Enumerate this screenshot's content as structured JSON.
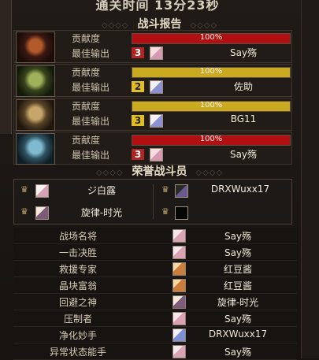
{
  "header": {
    "title": "通关时间 13分23秒"
  },
  "sections": {
    "battle_report": "战斗报告",
    "honor_members": "荣誉战斗员"
  },
  "report": [
    {
      "portrait": "red",
      "contribution_label": "贡献度",
      "contribution_value": "100%",
      "contribution_fill": 1.0,
      "contribution_color": "#b10f12",
      "best_label": "最佳输出",
      "rank": "3",
      "rank_color": "#b32424",
      "name": "Say殇"
    },
    {
      "portrait": "green",
      "contribution_label": "贡献度",
      "contribution_value": "100%",
      "contribution_fill": 1.0,
      "contribution_color": "#c9aa20",
      "best_label": "最佳输出",
      "rank": "2",
      "rank_color": "#e0be1f",
      "name": "佐助"
    },
    {
      "portrait": "gold",
      "contribution_label": "贡献度",
      "contribution_value": "100%",
      "contribution_fill": 1.0,
      "contribution_color": "#c9aa20",
      "best_label": "最佳输出",
      "rank": "3",
      "rank_color": "#e0be1f",
      "name": "BG11"
    },
    {
      "portrait": "teal",
      "contribution_label": "贡献度",
      "contribution_value": "100%",
      "contribution_fill": 1.0,
      "contribution_color": "#b10f12",
      "best_label": "最佳输出",
      "rank": "3",
      "rank_color": "#b32424",
      "name": "Say殇"
    }
  ],
  "honor": [
    {
      "name": "ジ白露"
    },
    {
      "name": "DRXWuxx17"
    },
    {
      "name": "旋律-时光"
    },
    {
      "name": ""
    }
  ],
  "awards": [
    {
      "title": "战场名将",
      "name": "Say殇",
      "avatar": "pinkish"
    },
    {
      "title": "一击决胜",
      "name": "Say殇",
      "avatar": "pinkish"
    },
    {
      "title": "救援专家",
      "name": "红豆酱",
      "avatar": "orange"
    },
    {
      "title": "晶块富翁",
      "name": "红豆酱",
      "avatar": "orange"
    },
    {
      "title": "回避之神",
      "name": "旋律-时光",
      "avatar": "mixed"
    },
    {
      "title": "压制者",
      "name": "Say殇",
      "avatar": "pinkish"
    },
    {
      "title": "净化妙手",
      "name": "DRXWuxx17",
      "avatar": "blue"
    },
    {
      "title": "异常状态能手",
      "name": "Say殇",
      "avatar": "pinkish"
    }
  ]
}
